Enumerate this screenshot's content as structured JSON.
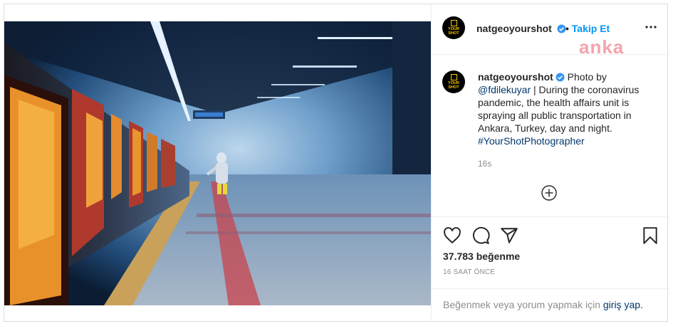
{
  "post": {
    "username": "natgeoyourshot",
    "separator": "•",
    "follow_label": "Takip Et",
    "avatar_text": [
      "YOUR",
      "SHOT"
    ],
    "watermark": "anka",
    "caption": {
      "username": "natgeoyourshot",
      "text_1": "Photo by",
      "mention": "@fdilekuyar",
      "text_2": "| During the coronavirus pandemic, the health affairs unit is spraying all public transportation in Ankara, Turkey, day and night.",
      "hashtag": "#YourShotPhotographer"
    },
    "comment_time": "16s",
    "likes": "37.783 beğenme",
    "posted_ago": "16 SAAT ÖNCE",
    "login_prompt": "Beğenmek veya yorum yapmak için",
    "login_link": "giriş yap."
  },
  "colors": {
    "link": "#0095f6",
    "verified": "#3897f0",
    "watermark": "#f5a3ad"
  },
  "icons": [
    "more-options-icon",
    "verified-badge-icon",
    "add-comment-icon",
    "heart-icon",
    "comment-icon",
    "share-icon",
    "bookmark-icon"
  ]
}
